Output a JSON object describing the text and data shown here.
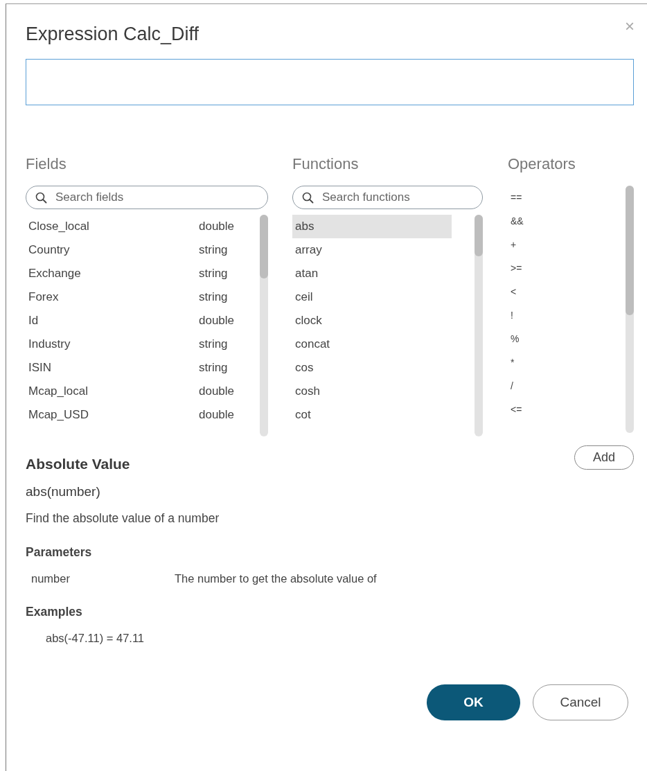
{
  "dialog": {
    "title": "Expression Calc_Diff",
    "close": "×"
  },
  "fields": {
    "heading": "Fields",
    "search": {
      "placeholder": "Search fields"
    },
    "items": [
      {
        "name": "Close_local",
        "type": "double",
        "selected": false
      },
      {
        "name": "Country",
        "type": "string",
        "selected": false
      },
      {
        "name": "Exchange",
        "type": "string",
        "selected": false
      },
      {
        "name": "Forex",
        "type": "string",
        "selected": false
      },
      {
        "name": "Id",
        "type": "double",
        "selected": false
      },
      {
        "name": "Industry",
        "type": "string",
        "selected": false
      },
      {
        "name": "ISIN",
        "type": "string",
        "selected": false
      },
      {
        "name": "Mcap_local",
        "type": "double",
        "selected": false
      },
      {
        "name": "Mcap_USD",
        "type": "double",
        "selected": false
      }
    ]
  },
  "functions": {
    "heading": "Functions",
    "search": {
      "placeholder": "Search functions"
    },
    "items": [
      {
        "name": "abs",
        "selected": true
      },
      {
        "name": "array",
        "selected": false
      },
      {
        "name": "atan",
        "selected": false
      },
      {
        "name": "ceil",
        "selected": false
      },
      {
        "name": "clock",
        "selected": false
      },
      {
        "name": "concat",
        "selected": false
      },
      {
        "name": "cos",
        "selected": false
      },
      {
        "name": "cosh",
        "selected": false
      },
      {
        "name": "cot",
        "selected": false
      }
    ]
  },
  "operators": {
    "heading": "Operators",
    "items": [
      {
        "symbol": "==",
        "selected": false
      },
      {
        "symbol": "&&",
        "selected": false
      },
      {
        "symbol": "+",
        "selected": false
      },
      {
        "symbol": ">=",
        "selected": false
      },
      {
        "symbol": "<",
        "selected": false
      },
      {
        "symbol": "!",
        "selected": false
      },
      {
        "symbol": "%",
        "selected": false
      },
      {
        "symbol": "*",
        "selected": false
      },
      {
        "symbol": "/",
        "selected": false
      },
      {
        "symbol": "<=",
        "selected": false
      }
    ]
  },
  "add_button": "Add",
  "help": {
    "title": "Absolute Value",
    "signature": "abs(number)",
    "description": "Find the absolute value of a number",
    "parameters_heading": "Parameters",
    "parameters": [
      {
        "name": "number",
        "description": "The number to get the absolute value of"
      }
    ],
    "examples_heading": "Examples",
    "examples": [
      "abs(-47.11) = 47.11"
    ]
  },
  "buttons": [
    {
      "label": "OK",
      "kind": "primary"
    },
    {
      "label": "Cancel",
      "kind": "secondary"
    }
  ]
}
